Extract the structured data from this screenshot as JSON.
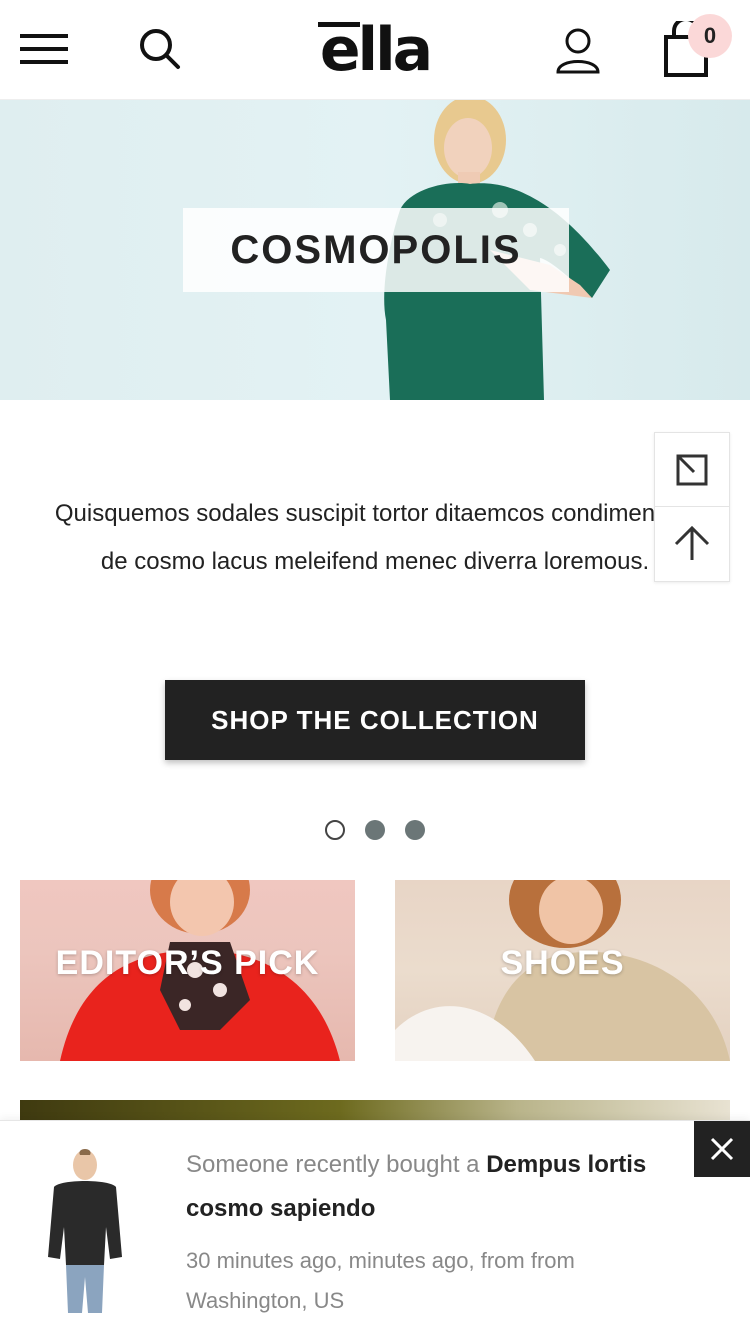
{
  "header": {
    "logo": "ella",
    "cart_count": "0"
  },
  "icons": {
    "menu": "menu-icon",
    "search": "search-icon",
    "account": "user-icon",
    "cart": "shopping-bag-icon",
    "expand": "expand-icon",
    "scroll_top": "arrow-up-icon",
    "close": "close-icon"
  },
  "hero": {
    "title": "COSMOPOLIS"
  },
  "description": "Quisquemos sodales suscipit tortor ditaemcos condimentum de cosmo lacus meleifend menec diverra loremous.",
  "cta": {
    "label": "SHOP THE COLLECTION"
  },
  "slider": {
    "count": 3,
    "active_index": 0
  },
  "categories": [
    {
      "label": "EDITOR’S PICK"
    },
    {
      "label": "SHOES"
    }
  ],
  "popup": {
    "prefix": "Someone recently bought a",
    "product": "Dempus lortis cosmo sapiendo",
    "meta": "30 minutes ago, minutes ago, from from Washington, US"
  },
  "colors": {
    "primary": "#222222",
    "cart_badge": "#fbd8d8",
    "muted_text": "#888888",
    "dot_inactive": "#6b7677"
  }
}
